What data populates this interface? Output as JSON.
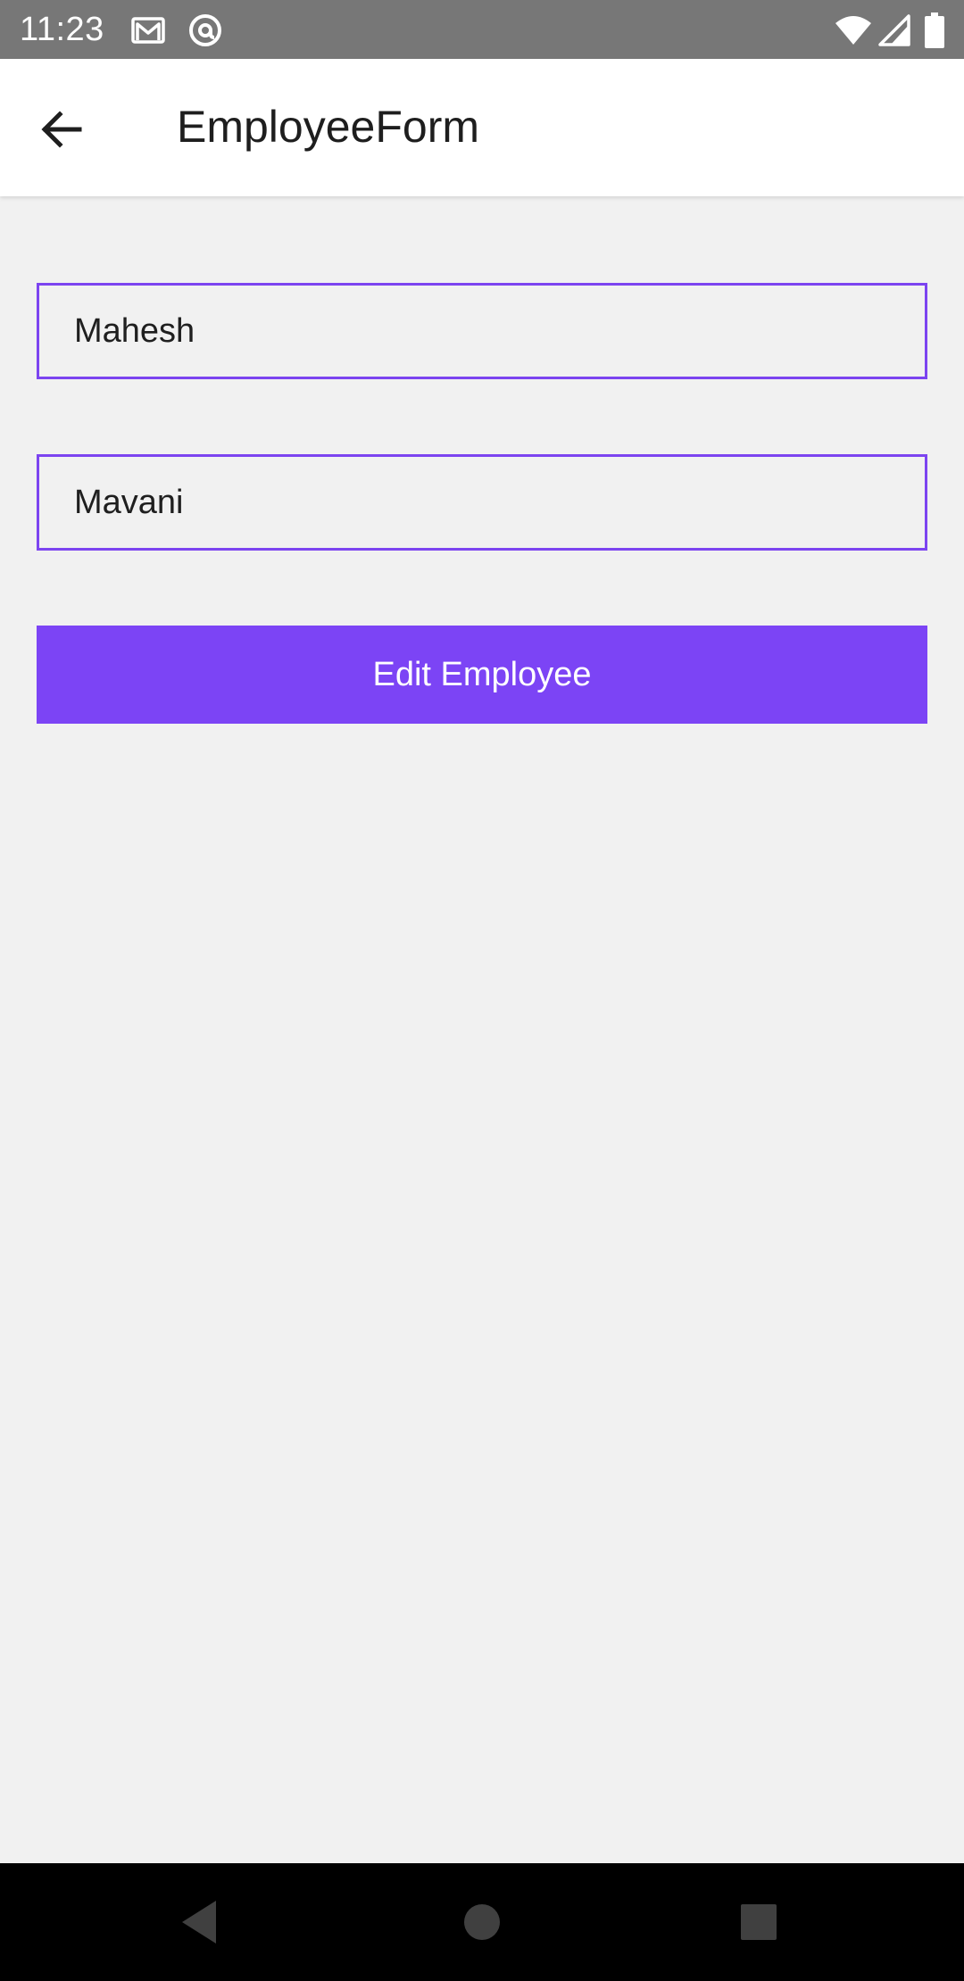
{
  "status_bar": {
    "time": "11:23",
    "icons": [
      "gmail-icon",
      "at-sign-icon",
      "wifi-icon",
      "signal-icon",
      "battery-icon"
    ]
  },
  "app_bar": {
    "title": "EmployeeForm",
    "back_icon": "arrow-left-icon"
  },
  "form": {
    "first_name_value": "Mahesh",
    "last_name_value": "Mavani",
    "submit_label": "Edit Employee"
  },
  "nav_bar": {
    "icons": [
      "nav-back-icon",
      "nav-home-icon",
      "nav-recents-icon"
    ]
  },
  "colors": {
    "accent": "#7c44f5",
    "status_bar": "#777777",
    "background": "#f1f1f1",
    "nav_bar": "#000000"
  }
}
